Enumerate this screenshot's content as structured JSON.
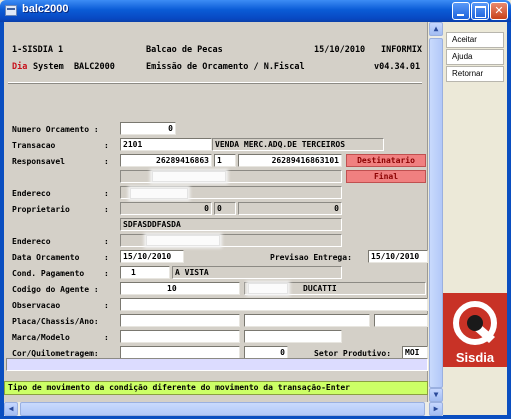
{
  "window": {
    "title": "balc2000"
  },
  "header": {
    "line1_left": "1-SISDIA 1",
    "line1_center": "Balcao de Pecas",
    "line1_date": "15/10/2010",
    "line1_right": "INFORMIX",
    "line2_day": "Dia",
    "line2_system": "System  BALC2000",
    "line2_center": "Emissão de Orcamento / N.Fiscal",
    "line2_version": "v04.34.01"
  },
  "form": {
    "numero_orcamento": {
      "label": "Numero Orcamento :",
      "value": "0"
    },
    "transacao": {
      "label": "Transacao",
      "colon": ":",
      "code": "2101",
      "description": "VENDA MERC.ADQ.DE TERCEIROS"
    },
    "responsavel": {
      "label": "Responsavel",
      "colon": ":",
      "value1": "26289416863",
      "value2": "1",
      "value3": "26289416863101"
    },
    "destinatario_button": "Destinatario",
    "final_button": "Final",
    "endereco1": {
      "label": "Endereco",
      "colon": ":"
    },
    "proprietario": {
      "label": "Proprietario",
      "colon": ":",
      "value1": "0",
      "value2": "0",
      "value3": "0",
      "name": "SDFASDDFASDA"
    },
    "endereco2": {
      "label": "Endereco",
      "colon": ":"
    },
    "data_orcamento": {
      "label": "Data Orcamento",
      "colon": ":",
      "value": "15/10/2010"
    },
    "previsao_entrega": {
      "label": "Previsao Entrega:",
      "value": "15/10/2010"
    },
    "cond_pagamento": {
      "label": "Cond. Pagamento",
      "colon": ":",
      "code": "1",
      "description": "A VISTA"
    },
    "codigo_agente": {
      "label": "Codigo do Agente :",
      "code": "10",
      "name": "DUCATTI"
    },
    "observacao": {
      "label": "Observacao",
      "colon": ":"
    },
    "placa": {
      "label": "Placa/Chassis/Ano:"
    },
    "marca": {
      "label": "Marca/Modelo",
      "colon": ":"
    },
    "cor": {
      "label": "Cor/Quilometragem:",
      "km": "0"
    },
    "setor_produtivo": {
      "label": "Setor Produtivo:",
      "value": "MOI"
    }
  },
  "message": "Tipo de movimento da condição diferente do movimento da transação-Enter",
  "side_buttons": [
    "Aceitar",
    "Ajuda",
    "Retornar"
  ],
  "logo": {
    "text": "Sisdia",
    "color": "#c83226"
  },
  "colors": {
    "title_bar": "#0a5bd6",
    "message_bar": "#ccff66",
    "pink_button": "#f08080"
  }
}
